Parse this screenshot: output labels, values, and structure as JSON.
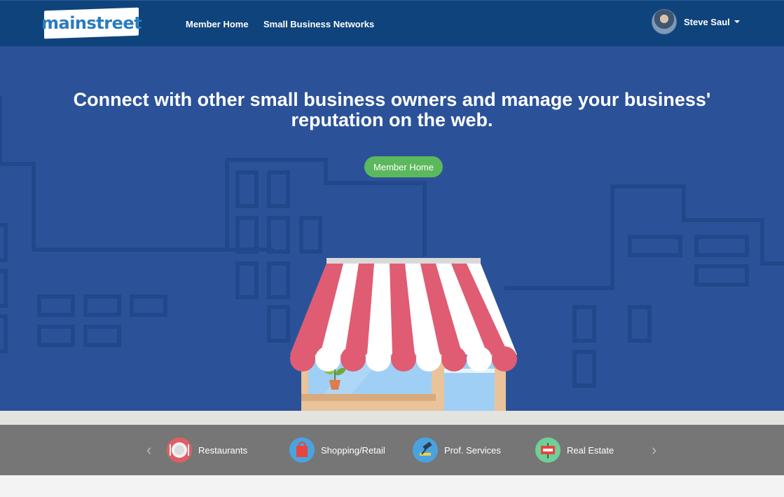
{
  "nav": {
    "logo": "mainstreet",
    "links": [
      "Member Home",
      "Small Business Networks"
    ],
    "user_name": "Steve Saul"
  },
  "hero": {
    "title_line1": "Connect with other small business owners and manage your business'",
    "title_line2": "reputation on the web.",
    "button": "Member Home"
  },
  "categories": {
    "prev": "‹",
    "next": "›",
    "items": [
      {
        "label": "Restaurants",
        "icon": "plate-icon",
        "color": "#e05e63"
      },
      {
        "label": "Shopping/Retail",
        "icon": "shopping-bag-icon",
        "color": "#4aa3df"
      },
      {
        "label": "Prof. Services",
        "icon": "gavel-icon",
        "color": "#4aa3df"
      },
      {
        "label": "Real Estate",
        "icon": "for-sale-sign-icon",
        "color": "#6fcf97"
      }
    ]
  },
  "colors": {
    "nav": "#0f437c",
    "hero": "#2b5299",
    "button": "#5cb85c",
    "awning_red": "#e05c72"
  }
}
